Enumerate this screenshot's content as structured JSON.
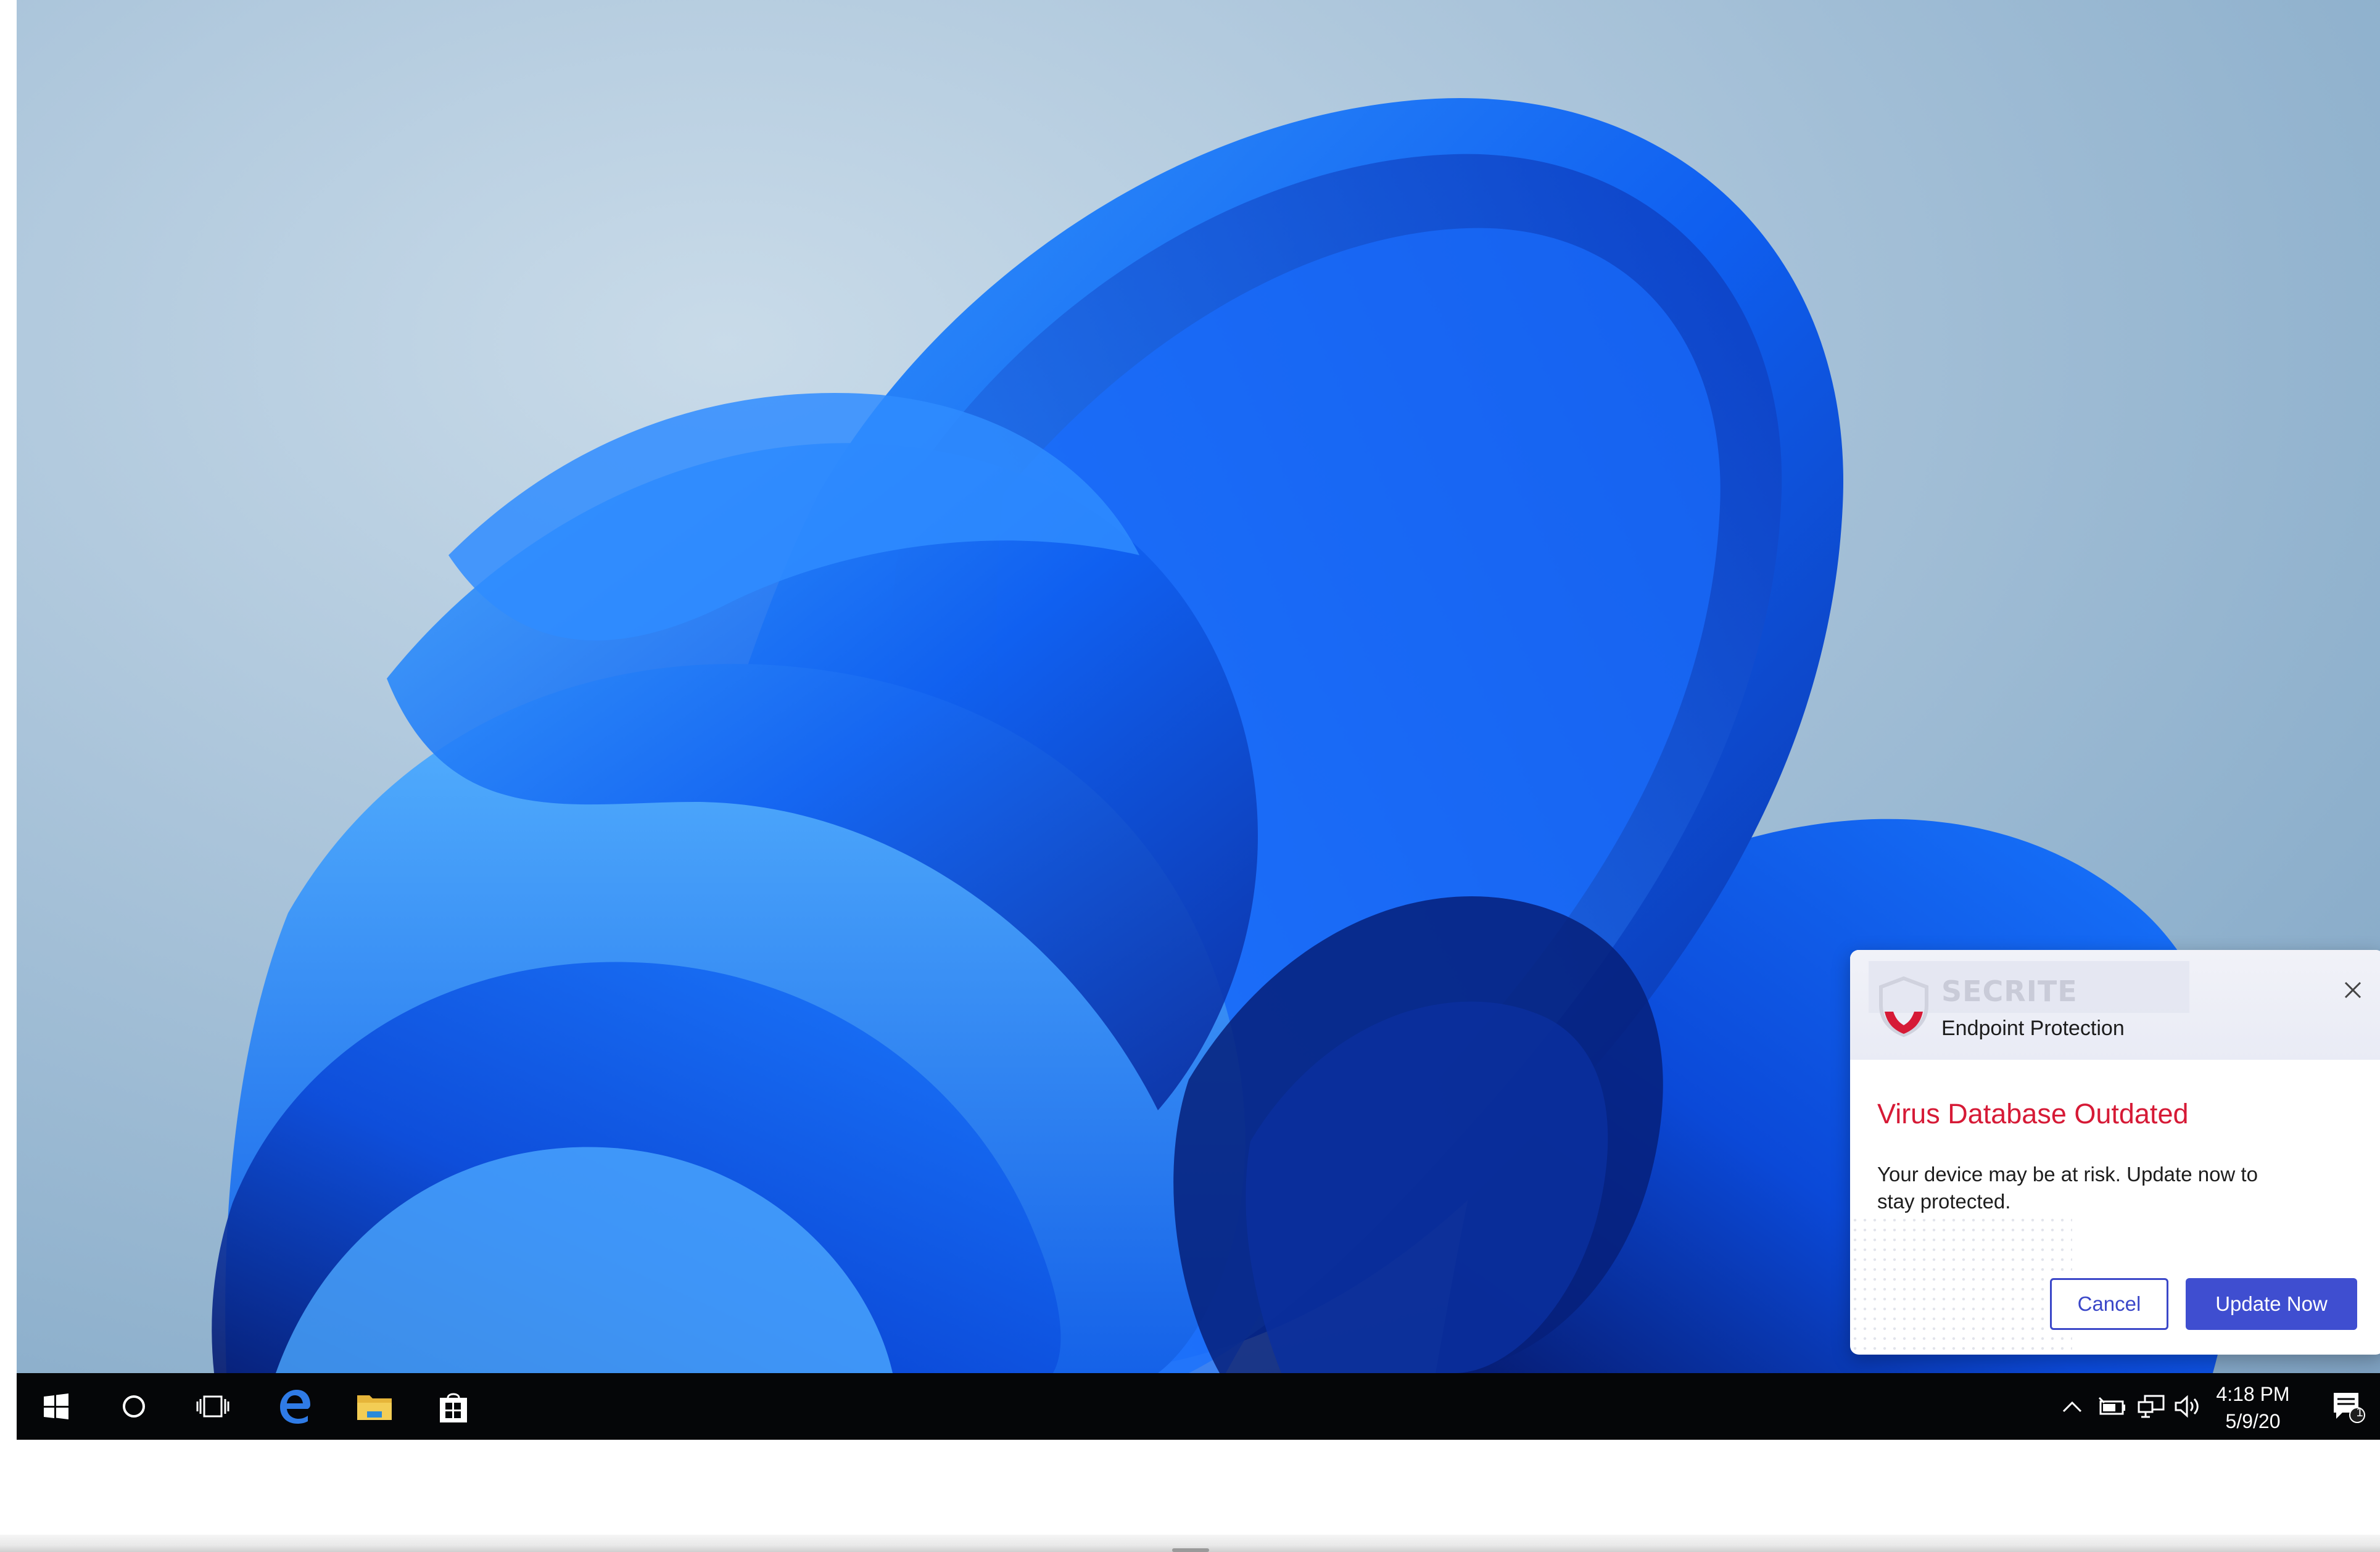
{
  "taskbar": {
    "icons": [
      "windows-start-icon",
      "cortana-search-icon",
      "task-view-icon",
      "edge-browser-icon",
      "file-explorer-icon",
      "store-icon"
    ],
    "tray_icons": [
      "chevron-up-icon",
      "battery-icon",
      "network-icon",
      "volume-icon"
    ],
    "clock": {
      "time": "4:18 PM",
      "date": "5/9/20"
    },
    "notification_count": "1"
  },
  "notification": {
    "brand": "SECRITE",
    "product": "Endpoint Protection",
    "title": "Virus Database Outdated",
    "message": "Your device may be at risk. Update now to stay protected.",
    "cancel_label": "Cancel",
    "update_label": "Update Now",
    "colors": {
      "title": "#d61a36",
      "primary_button": "#3f4ed0",
      "shield": "#d61a36"
    }
  }
}
